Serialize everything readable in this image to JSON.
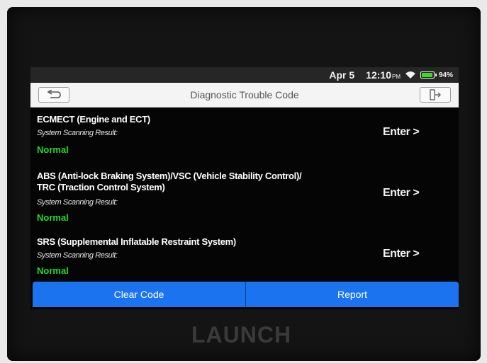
{
  "status_bar": {
    "date": "Apr 5",
    "time": "12:10",
    "ampm": "PM",
    "battery_percent": "94%",
    "battery_level": 0.94
  },
  "header": {
    "title": "Diagnostic Trouble Code",
    "back_icon": "back-arrow-icon",
    "exit_icon": "exit-icon"
  },
  "systems": [
    {
      "name_lines": [
        "ECMECT (Engine and ECT)"
      ],
      "result_label": "System Scanning Result:",
      "result": "Normal",
      "action": "Enter >"
    },
    {
      "name_lines": [
        "ABS (Anti-lock Braking System)/VSC (Vehicle Stability Control)/",
        "TRC (Traction Control System)"
      ],
      "result_label": "System Scanning Result:",
      "result": "Normal",
      "action": "Enter >"
    },
    {
      "name_lines": [
        "SRS (Supplemental Inflatable Restraint System)"
      ],
      "result_label": "System Scanning Result:",
      "result": "Normal",
      "action": "Enter >"
    }
  ],
  "footer": {
    "clear_code": "Clear Code",
    "report": "Report"
  },
  "device": {
    "brand": "LAUNCH"
  },
  "colors": {
    "accent": "#1b73f0",
    "normal": "#1fdc2a",
    "battery": "#3ddc1a"
  }
}
